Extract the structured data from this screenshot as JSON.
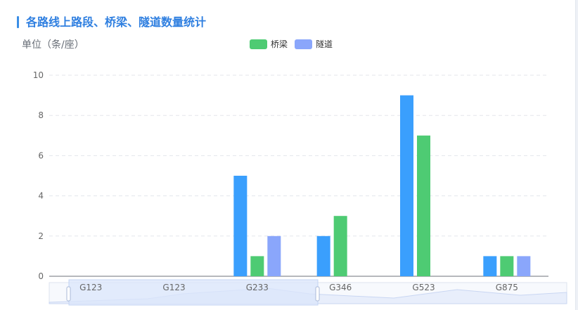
{
  "title": "各路线上路段、桥梁、隧道数量统计",
  "unit_label": "单位（条/座）",
  "colors": {
    "accent": "#2f7fe0",
    "road": "#3a9ffd",
    "bridge": "#4ecb73",
    "tunnel": "#8aa6fb"
  },
  "chart_data": {
    "type": "bar",
    "categories": [
      "G123",
      "G123",
      "G233",
      "G346",
      "G523",
      "G875"
    ],
    "series": [
      {
        "name": "",
        "values": [
          0,
          0,
          5,
          2,
          9,
          1
        ]
      },
      {
        "name": "桥梁",
        "values": [
          0,
          0,
          1,
          3,
          7,
          1
        ]
      },
      {
        "name": "隧道",
        "values": [
          0,
          0,
          2,
          0,
          0,
          1
        ]
      }
    ],
    "yticks": [
      "0",
      "2",
      "4",
      "6",
      "8",
      "10"
    ],
    "ylim": [
      0,
      10
    ],
    "grid": true,
    "legend_placement": "top-center",
    "legend": [
      "桥梁",
      "隧道"
    ]
  }
}
